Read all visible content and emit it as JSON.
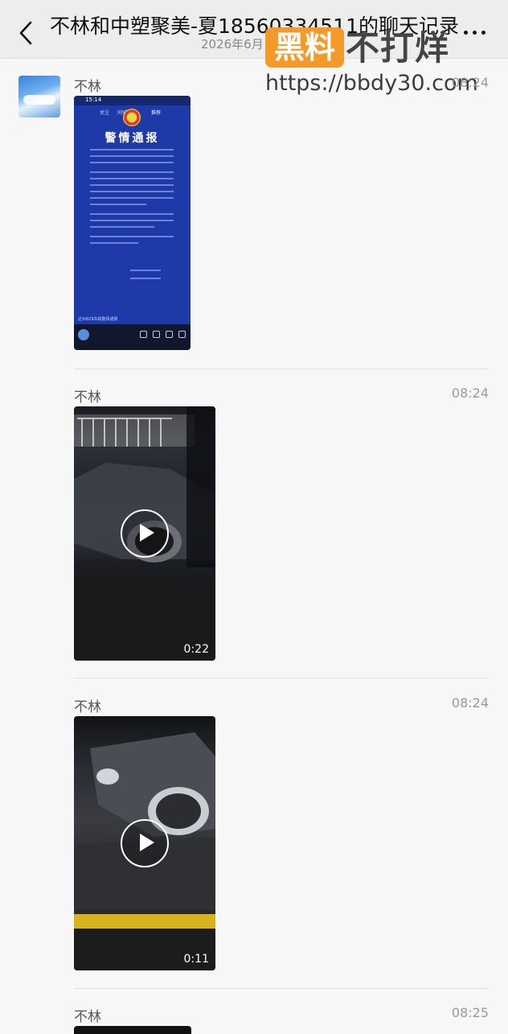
{
  "header": {
    "title": "不林和中塑聚美-夏18560334511的聊天记录",
    "subtitle": "2026年6月"
  },
  "watermark": {
    "badge": "黑料",
    "text": "不打烊",
    "url": "https://bbdy30.com"
  },
  "messages": [
    {
      "sender": "不林",
      "time": "08:24",
      "type": "image",
      "image": {
        "status_time": "15:14",
        "tabs": [
          "关注",
          "同城",
          "推荐"
        ],
        "title": "警情通报",
        "caption": "达州829车祸警情通报"
      }
    },
    {
      "sender": "不林",
      "time": "08:24",
      "type": "video",
      "duration": "0:22"
    },
    {
      "sender": "不林",
      "time": "08:24",
      "type": "video",
      "duration": "0:11"
    },
    {
      "sender": "不林",
      "time": "08:25",
      "type": "video"
    }
  ],
  "colors": {
    "header_bg": "#ededed",
    "page_bg": "#f7f7f7",
    "notice_blue": "#1d3aa8",
    "watermark_orange": "#f39a2b"
  }
}
